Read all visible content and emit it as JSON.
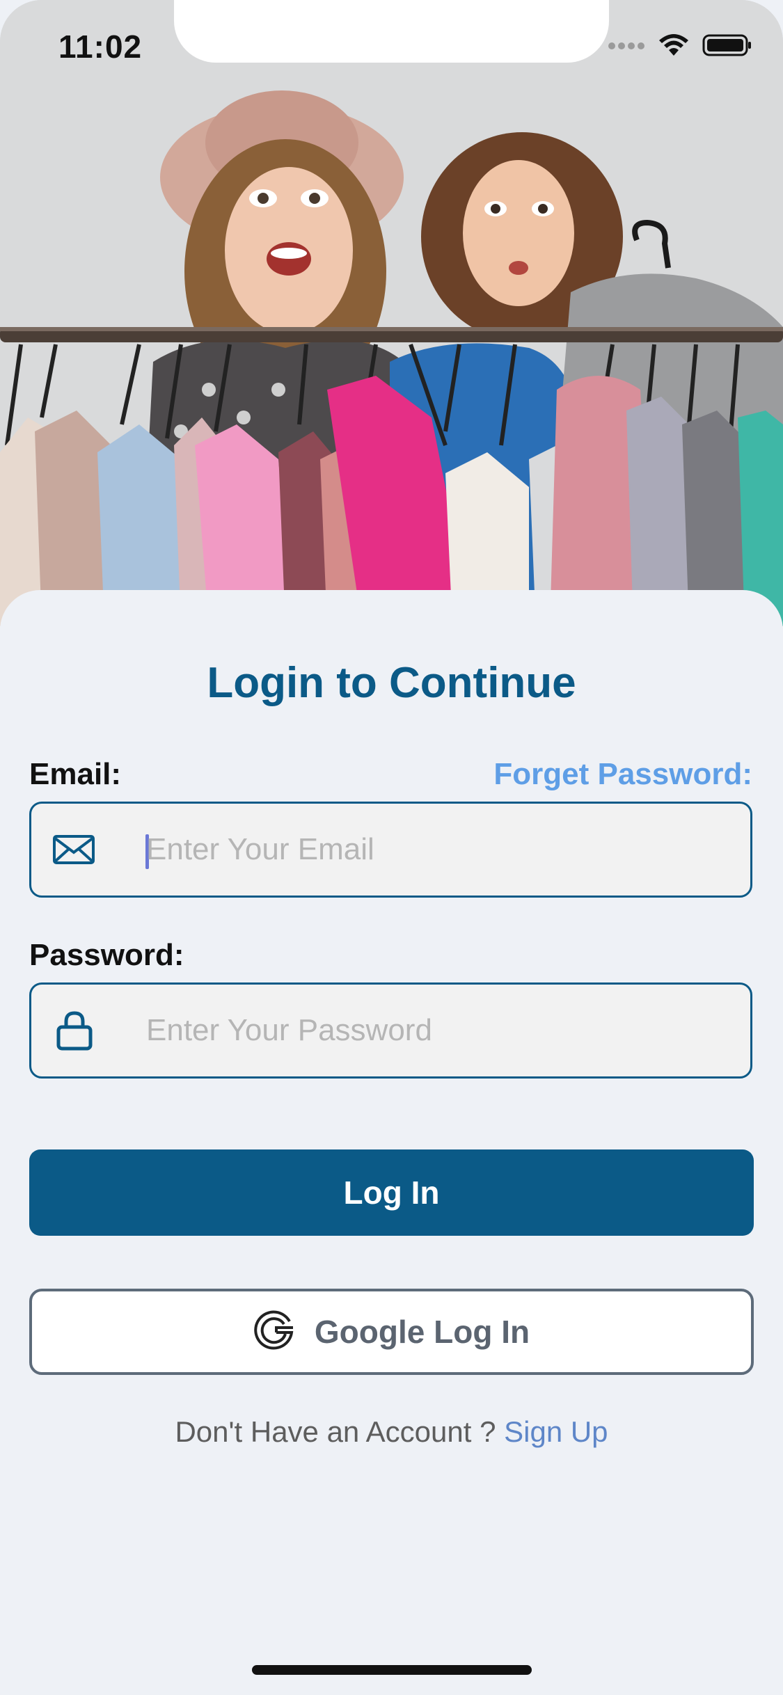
{
  "status_bar": {
    "time": "11:02",
    "icons": [
      "signal-dots-icon",
      "wifi-icon",
      "battery-icon"
    ]
  },
  "hero": {
    "image": "hero-photo"
  },
  "login": {
    "title": "Login to Continue",
    "email_label": "Email:",
    "forgot_password": "Forget Password:",
    "email_placeholder": "Enter Your Email",
    "email_value": "",
    "password_label": "Password:",
    "password_placeholder": "Enter Your Password",
    "password_value": "",
    "login_button": "Log In",
    "google_button": "Google Log In",
    "signup_prompt": "Don't Have an Account ? ",
    "signup_link": "Sign Up"
  },
  "colors": {
    "primary": "#0b5a87",
    "link": "#5e9ee6",
    "background": "#eef1f6",
    "field_bg": "#f2f2f2",
    "google_border": "#5d6b7a"
  }
}
